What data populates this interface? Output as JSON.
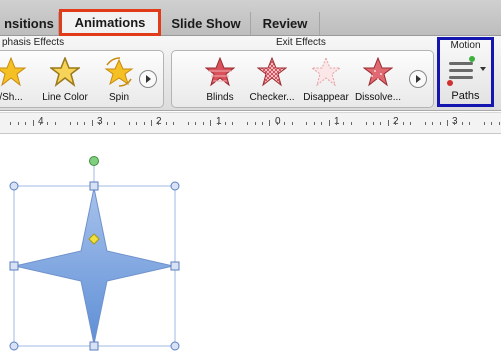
{
  "tabs": [
    {
      "label": "nsitions",
      "active": false
    },
    {
      "label": "Animations",
      "active": true
    },
    {
      "label": "Slide Show",
      "active": false
    },
    {
      "label": "Review",
      "active": false
    }
  ],
  "ribbon": {
    "emphasis_group": {
      "title": "phasis Effects",
      "items": [
        {
          "label": "/Sh...",
          "icon": "gold-star-icon"
        },
        {
          "label": "Line Color",
          "icon": "gold-star-outline-icon"
        },
        {
          "label": "Spin",
          "icon": "spinning-star-icon"
        }
      ]
    },
    "exit_group": {
      "title": "Exit Effects",
      "items": [
        {
          "label": "Blinds",
          "icon": "red-star-blinds-icon"
        },
        {
          "label": "Checker...",
          "icon": "red-star-checker-icon"
        },
        {
          "label": "Disappear",
          "icon": "faded-star-icon"
        },
        {
          "label": "Dissolve...",
          "icon": "red-star-dissolve-icon"
        }
      ]
    },
    "motion_group": {
      "title": "Motion",
      "button_label": "Paths"
    }
  },
  "ruler": {
    "labels": [
      "4",
      "3",
      "2",
      "1",
      "0",
      "1",
      "2",
      "3"
    ]
  },
  "colors": {
    "active_tab_border": "#e03c1a",
    "motion_highlight": "#1515b0",
    "shape_fill": "#7aa3dd",
    "selection_handle": "#5a7fc0",
    "rotation_handle": "#6ab56a",
    "adjust_handle": "#e3d13a"
  }
}
